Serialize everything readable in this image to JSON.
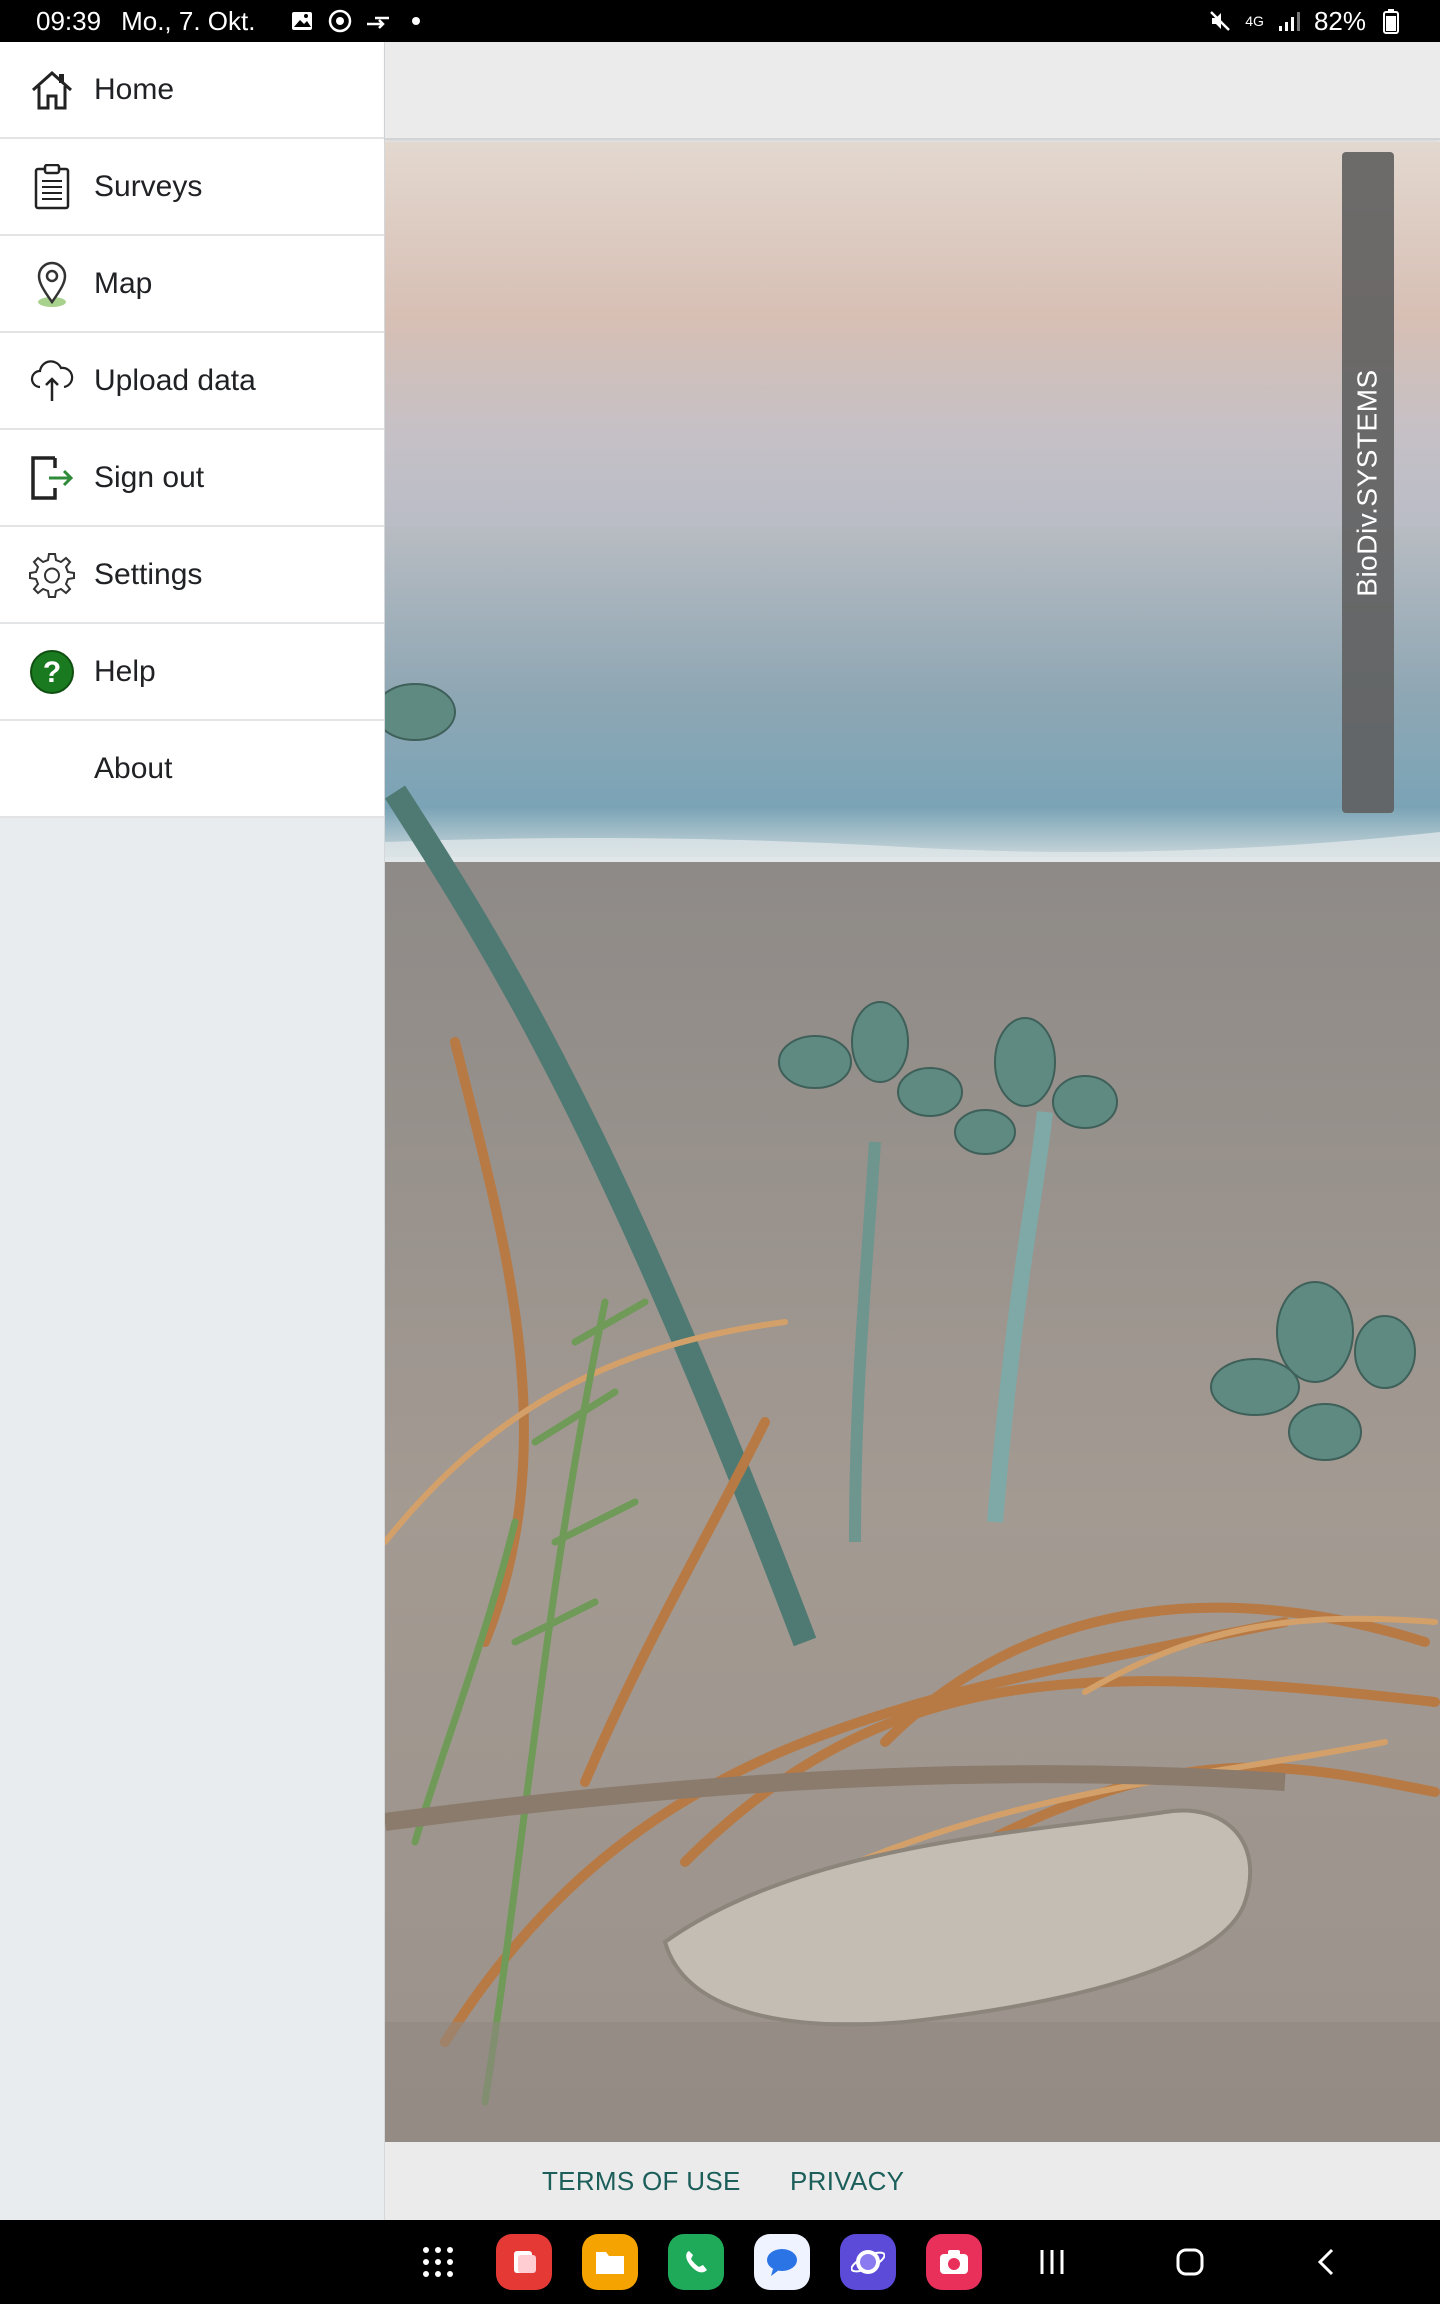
{
  "status_bar": {
    "time": "09:39",
    "date": "Mo., 7. Okt.",
    "network": "4G",
    "battery": "82%",
    "icons": [
      "image-icon",
      "circle-download-icon",
      "arrows-icon",
      "dot-icon",
      "mute-icon",
      "signal-icon",
      "battery-icon"
    ]
  },
  "drawer": {
    "items": [
      {
        "label": "Home",
        "icon": "home-icon"
      },
      {
        "label": "Surveys",
        "icon": "clipboard-icon"
      },
      {
        "label": "Map",
        "icon": "map-pin-icon"
      },
      {
        "label": "Upload data",
        "icon": "cloud-upload-icon"
      },
      {
        "label": "Sign out",
        "icon": "sign-out-icon"
      },
      {
        "label": "Settings",
        "icon": "gear-icon"
      },
      {
        "label": "Help",
        "icon": "help-icon"
      },
      {
        "label": "About",
        "icon": ""
      }
    ]
  },
  "main": {
    "brand_label": "BioDiv.SYSTEMS",
    "footer": {
      "terms_label": "TERMS OF USE",
      "privacy_label": "PRIVACY"
    }
  },
  "nav_bar": {
    "apps": [
      "app-drawer-icon",
      "flip-icon",
      "files-icon",
      "phone-icon",
      "messages-icon",
      "internet-icon",
      "camera-icon"
    ],
    "buttons": [
      "recents-button",
      "home-button",
      "back-button"
    ]
  },
  "colors": {
    "accent_green": "#2e8b3a",
    "link_teal": "#1b5e5a",
    "drawer_bg": "#e9ecef"
  }
}
